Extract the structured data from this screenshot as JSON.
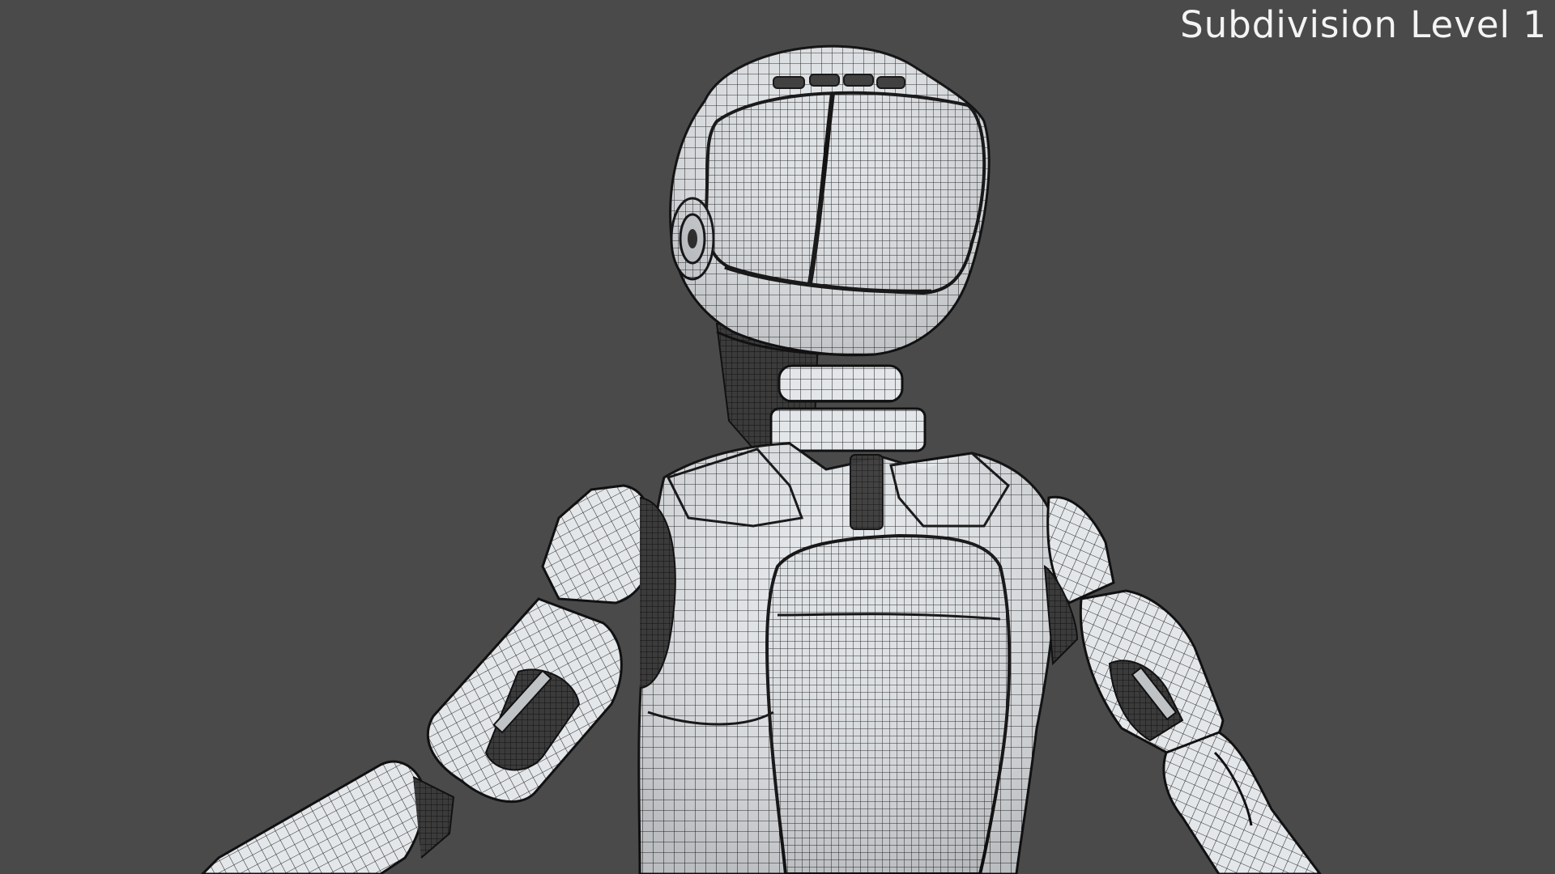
{
  "viewport": {
    "overlay_label": "Subdivision Level 1",
    "background_color": "#4a4a4a",
    "mesh_fill_color": "#e6e9ec",
    "wire_color": "#1b1b1b",
    "subject_icon": "robot-wireframe-model-icon"
  }
}
